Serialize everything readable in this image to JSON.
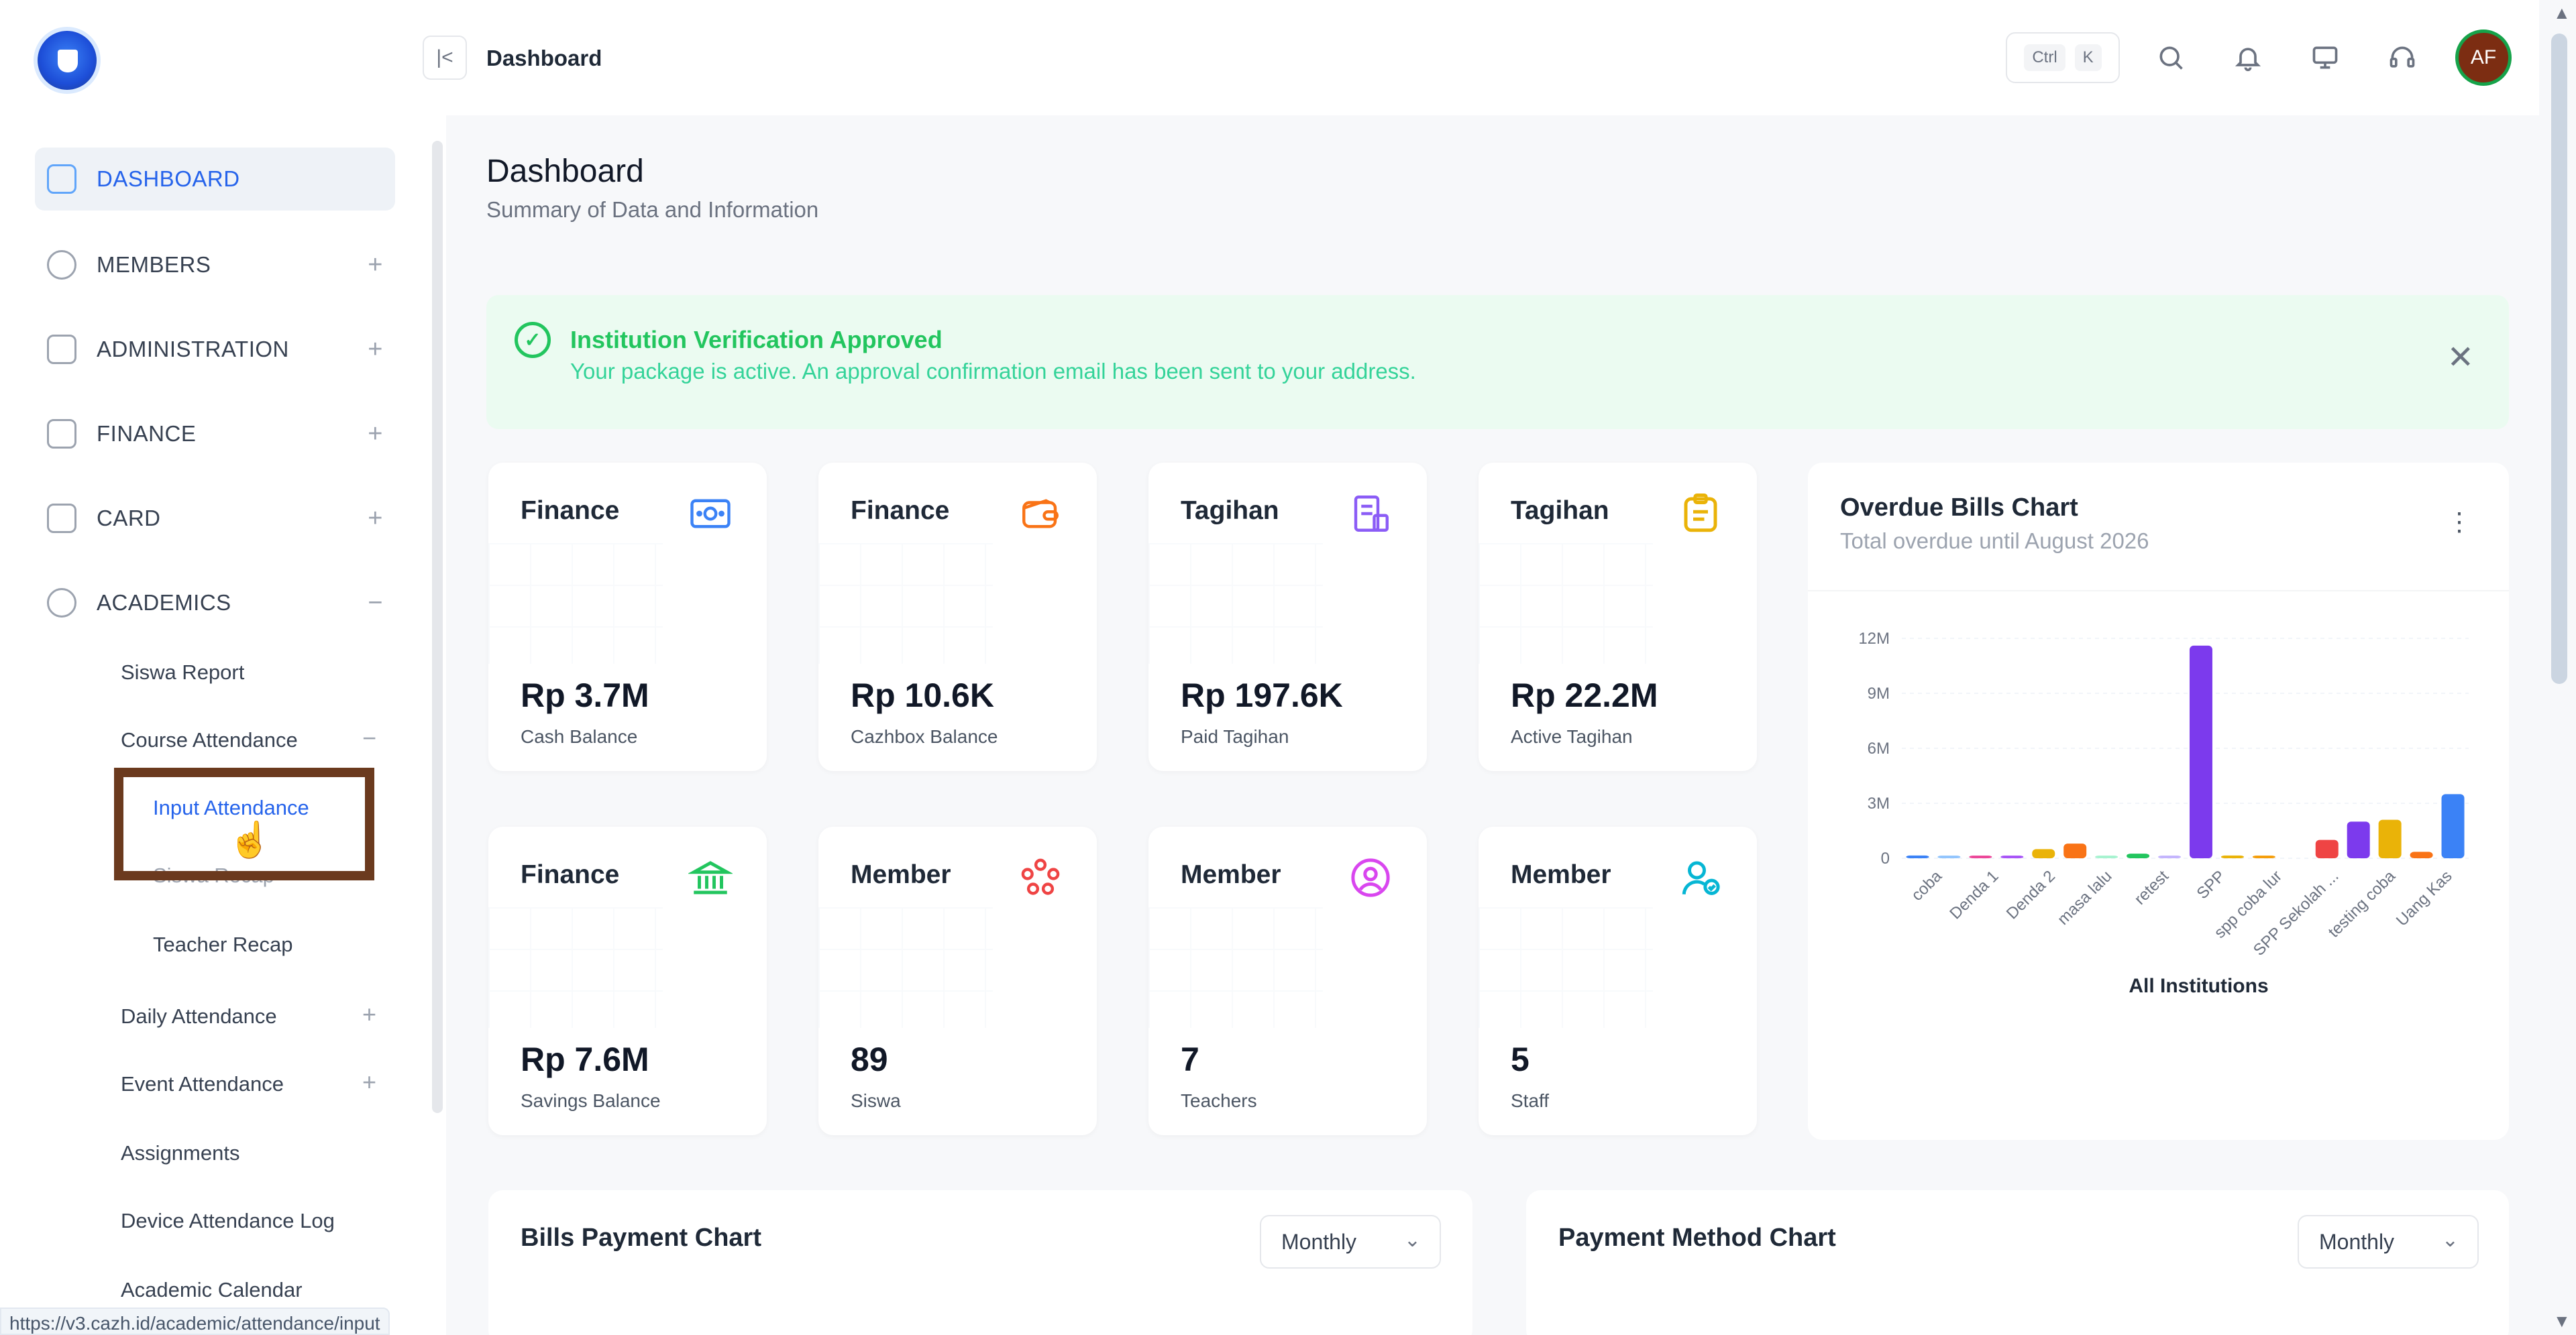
{
  "browser": {
    "status_url": "https://v3.cazh.id/academic/attendance/input"
  },
  "sidebar": {
    "items": [
      {
        "label": "DASHBOARD",
        "icon": "grid-icon",
        "active": true
      },
      {
        "label": "MEMBERS",
        "icon": "users-icon",
        "expand": "+"
      },
      {
        "label": "ADMINISTRATION",
        "icon": "folder-icon",
        "expand": "+"
      },
      {
        "label": "FINANCE",
        "icon": "money-icon",
        "expand": "+"
      },
      {
        "label": "CARD",
        "icon": "card-icon",
        "expand": "+"
      },
      {
        "label": "ACADEMICS",
        "icon": "academics-icon",
        "expand": "−"
      }
    ],
    "academics": {
      "siswa_report": "Siswa Report",
      "course_attendance": "Course Attendance",
      "course_attendance_toggle": "−",
      "input_attendance": "Input Attendance",
      "siswa_recap": "Siswa Recap",
      "teacher_recap": "Teacher Recap",
      "daily_attendance": "Daily Attendance",
      "daily_toggle": "+",
      "event_attendance": "Event Attendance",
      "event_toggle": "+",
      "assignments": "Assignments",
      "device_log": "Device Attendance Log",
      "academic_calendar": "Academic Calendar"
    }
  },
  "header": {
    "collapse_icon": "collapse-left-icon",
    "breadcrumb": "Dashboard",
    "kbd_ctrl": "Ctrl",
    "kbd_k": "K",
    "avatar_initials": "AF"
  },
  "main": {
    "title": "Dashboard",
    "subtitle": "Summary of Data and Information",
    "alert": {
      "title": "Institution Verification Approved",
      "message": "Your package is active. An approval confirmation email has been sent to your address.",
      "close": "✕",
      "color": "#22c55e"
    },
    "cards": [
      {
        "label": "Finance",
        "value": "Rp 3.7M",
        "caption": "Cash Balance",
        "icon": "cash-icon",
        "color": "#3b82f6"
      },
      {
        "label": "Finance",
        "value": "Rp 10.6K",
        "caption": "Cazhbox Balance",
        "icon": "wallet-icon",
        "color": "#f97316"
      },
      {
        "label": "Tagihan",
        "value": "Rp 197.6K",
        "caption": "Paid Tagihan",
        "icon": "invoice-icon",
        "color": "#8b5cf6"
      },
      {
        "label": "Tagihan",
        "value": "Rp 22.2M",
        "caption": "Active Tagihan",
        "icon": "clipboard-icon",
        "color": "#eab308"
      },
      {
        "label": "Finance",
        "value": "Rp 7.6M",
        "caption": "Savings Balance",
        "icon": "bank-icon",
        "color": "#22c55e"
      },
      {
        "label": "Member",
        "value": "89",
        "caption": "Siswa",
        "icon": "group-icon",
        "color": "#ef4444"
      },
      {
        "label": "Member",
        "value": "7",
        "caption": "Teachers",
        "icon": "user-circle-icon",
        "color": "#d946ef"
      },
      {
        "label": "Member",
        "value": "5",
        "caption": "Staff",
        "icon": "user-check-icon",
        "color": "#06b6d4"
      }
    ],
    "overdue": {
      "title": "Overdue Bills Chart",
      "subtitle": "Total overdue until August 2026",
      "menu": "⋮"
    },
    "bills_payment": {
      "title": "Bills Payment Chart",
      "period": "Monthly"
    },
    "payment_method": {
      "title": "Payment Method Chart",
      "period": "Monthly"
    }
  },
  "chart_data": {
    "type": "bar",
    "title": "Overdue Bills Chart",
    "subtitle": "Total overdue until August 2026",
    "xlabel": "All Institutions",
    "ylabel": "",
    "ylim": [
      0,
      12000000
    ],
    "y_ticks": [
      "0",
      "3M",
      "6M",
      "9M",
      "12M"
    ],
    "y_tick_values": [
      0,
      3000000,
      6000000,
      9000000,
      12000000
    ],
    "x_tick_labels": [
      "coba",
      "Denda 1",
      "Denda 2",
      "masa lalu",
      "retest",
      "SPP",
      "spp coba lur",
      "SPP Sekolah ...",
      "testing coba",
      "Uang Kas"
    ],
    "bars": [
      {
        "value": 150000,
        "color": "#3b82f6"
      },
      {
        "value": 80000,
        "color": "#93c5fd"
      },
      {
        "value": 100000,
        "color": "#ec4899"
      },
      {
        "value": 80000,
        "color": "#a855f7"
      },
      {
        "value": 500000,
        "color": "#eab308"
      },
      {
        "value": 800000,
        "color": "#f97316"
      },
      {
        "value": 60000,
        "color": "#a7f3d0"
      },
      {
        "value": 250000,
        "color": "#22c55e"
      },
      {
        "value": 40000,
        "color": "#c4b5fd"
      },
      {
        "value": 11600000,
        "color": "#7c3aed"
      },
      {
        "value": 150000,
        "color": "#eab308"
      },
      {
        "value": 80000,
        "color": "#f59e0b"
      },
      {
        "value": 0,
        "color": "#f97316"
      },
      {
        "value": 1000000,
        "color": "#ef4444"
      },
      {
        "value": 2000000,
        "color": "#7c3aed"
      },
      {
        "value": 2100000,
        "color": "#eab308"
      },
      {
        "value": 350000,
        "color": "#f97316"
      },
      {
        "value": 3500000,
        "color": "#3b82f6"
      }
    ],
    "grid": true,
    "legend": "none"
  }
}
